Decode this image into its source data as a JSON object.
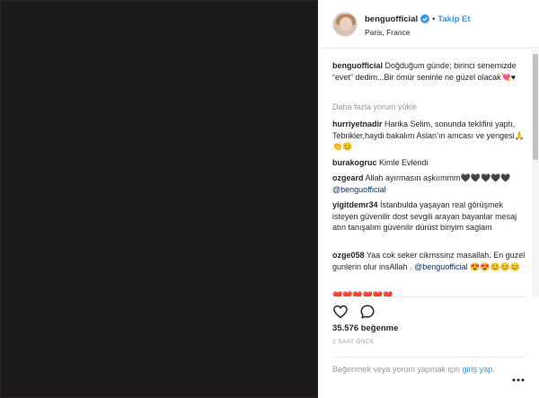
{
  "header": {
    "username": "benguofficial",
    "follow_label": "Takip Et",
    "location": "Paris, France",
    "dot": "•"
  },
  "caption": {
    "author": "benguofficial",
    "text": "Doğduğum günde; birinci senemizde “evet” dedim...Bir ömür seninle ne güzel olacak💘♥"
  },
  "load_more": "Daha fazla yorum yükle",
  "comments": [
    {
      "author": "hurriyetnadir",
      "text": "Harika Selim, sonunda teklifini yaptı, Tebrikler,haydi bakalım Aslan’ın amcası ve yengesi🙏👏😊"
    },
    {
      "author": "burakogruc",
      "text": "Kimle Evlendi"
    },
    {
      "author": "ozgeard",
      "text": "Allah ayırmasın aşkıımmm🖤🖤🖤🖤🖤",
      "mention": "@benguofficial"
    },
    {
      "author": "yigitdemr34",
      "text": "İstanbulda yaşayan real görüşmek isteyen güvenilir dost sevgili arayan bayanlar mesaj atın tanışalım güvenilir dürüst biriyim saglam"
    },
    {
      "author": "ozge058",
      "text": "Yaa cok seker cikmssinz masallah. En guzel gunlerin olur insAllah .",
      "mention": "@benguofficial",
      "emoji": "😍😍😊😊😊"
    },
    {
      "author": "",
      "text": "❤️❤️❤️❤️❤️❤️"
    }
  ],
  "likes_label": "35.576 beğenme",
  "time_label": "2 SAAT ÖNCE",
  "login_prompt": {
    "text": "Beğenmek veya yorum yapmak için",
    "link": "giriş yap."
  },
  "icons": {
    "like": "heart-icon",
    "comment": "comment-bubble-icon",
    "more": "more-dots-icon",
    "verified": "verified-badge-icon"
  },
  "colors": {
    "link": "#3897f0",
    "mention": "#003569",
    "muted": "#999999",
    "text": "#262626"
  }
}
